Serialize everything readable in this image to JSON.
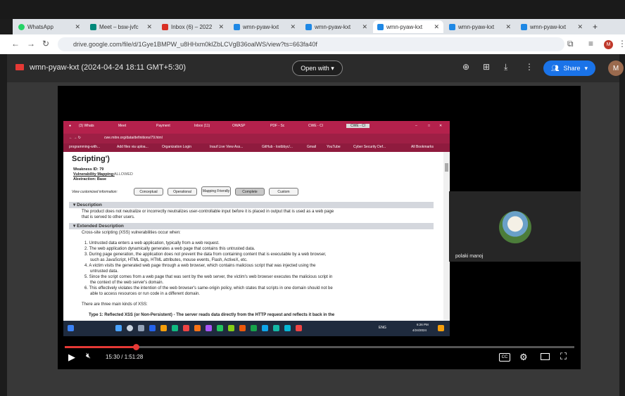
{
  "browser": {
    "tabs": [
      {
        "label": "WhatsApp",
        "color": "#25d366"
      },
      {
        "label": "Meet – bsw-jvfc",
        "color": "#00897b"
      },
      {
        "label": "Inbox (6) – 2022",
        "color": "#d93025"
      },
      {
        "label": "wmn-pyaw-kxt",
        "color": "#1e88e5"
      },
      {
        "label": "wmn-pyaw-kxt",
        "color": "#1e88e5"
      },
      {
        "label": "wmn-pyaw-kxt",
        "color": "#1e88e5"
      },
      {
        "label": "wmn-pyaw-kxt",
        "color": "#1e88e5"
      },
      {
        "label": "wmn-pyaw-kxt",
        "color": "#1e88e5"
      }
    ],
    "active_tab_index": 5,
    "url": "drive.google.com/file/d/1Gye1BMPW_u8HHxm0klZbLCVgB36oalWS/view?ts=663fa40f",
    "profile_initial": "M"
  },
  "drive": {
    "file_title": "wmn-pyaw-kxt (2024-04-24 18:11 GMT+5:30)",
    "open_with": "Open with",
    "share": "Share",
    "account_initial": "M"
  },
  "recording": {
    "tabs": [
      "(3) Whats",
      "Meet",
      "Payment",
      "Inbox (11)",
      "OWASP",
      "PDF - Sc",
      "CWE - Cl",
      "CWE - Cl"
    ],
    "url": "cwe.mitre.org/data/definitions/79.html",
    "bookmarks": [
      "programming-with...",
      "Add files via uploa...",
      "Organization Login",
      "Inauf Live View Ass...",
      "GitHub - lostbbyc/...",
      "Gmail",
      "YouTube",
      "Cyber Security Def...",
      "All Bookmarks"
    ],
    "page": {
      "heading": "Scripting')",
      "weakness_id": "Weakness ID: 79",
      "vuln_mapping_label": "Vulnerability Mapping:",
      "vuln_mapping_value": "ALLOWED",
      "abstraction": "Abstraction: Base",
      "view_label": "View customized information:",
      "view_buttons": [
        "Conceptual",
        "Operational",
        "Mapping Friendly",
        "Complete",
        "Custom"
      ],
      "description_header": "Description",
      "description_text": [
        "The product does not neutralize or incorrectly neutralizes user-controllable input before it is placed in output that is used as a web page",
        "that is served to other users."
      ],
      "extended_header": "Extended Description",
      "extended_intro": "Cross-site scripting (XSS) vulnerabilities occur when:",
      "list_items": [
        "1. Untrusted data enters a web application, typically from a web request.",
        "2. The web application dynamically generates a web page that contains this untrusted data.",
        "3. During page generation, the application does not prevent the data from containing content that is executable by a web browser,",
        "    such as JavaScript, HTML tags, HTML attributes, mouse events, Flash, ActiveX, etc.",
        "4. A victim visits the generated web page through a web browser, which contains malicious script that was injected using the",
        "    untrusted data.",
        "5. Since the script comes from a web page that was sent by the web server, the victim's web browser executes the malicious script in",
        "    the context of the web server's domain.",
        "6. This effectively violates the intention of the web browser's same-origin policy, which states that scripts in one domain should not be",
        "    able to access resources or run code in a different domain."
      ],
      "kinds_text": "There are three main kinds of XSS:",
      "type1_text": "Type 1: Reflected XSS (or Non-Persistent) - The server reads data directly from the HTTP request and reflects it back in the"
    },
    "taskbar_time": "6:26 PM",
    "taskbar_date": "4/24/2024",
    "taskbar_lang": "ENG"
  },
  "participant": {
    "name": "polaki manoj"
  },
  "player": {
    "current_time": "15:30 / 1:51:28",
    "progress_fraction": 0.139
  },
  "colors": {
    "accent_red": "#e53935",
    "share_blue": "#1a73e8",
    "cwe_bar": "#b4214c"
  }
}
